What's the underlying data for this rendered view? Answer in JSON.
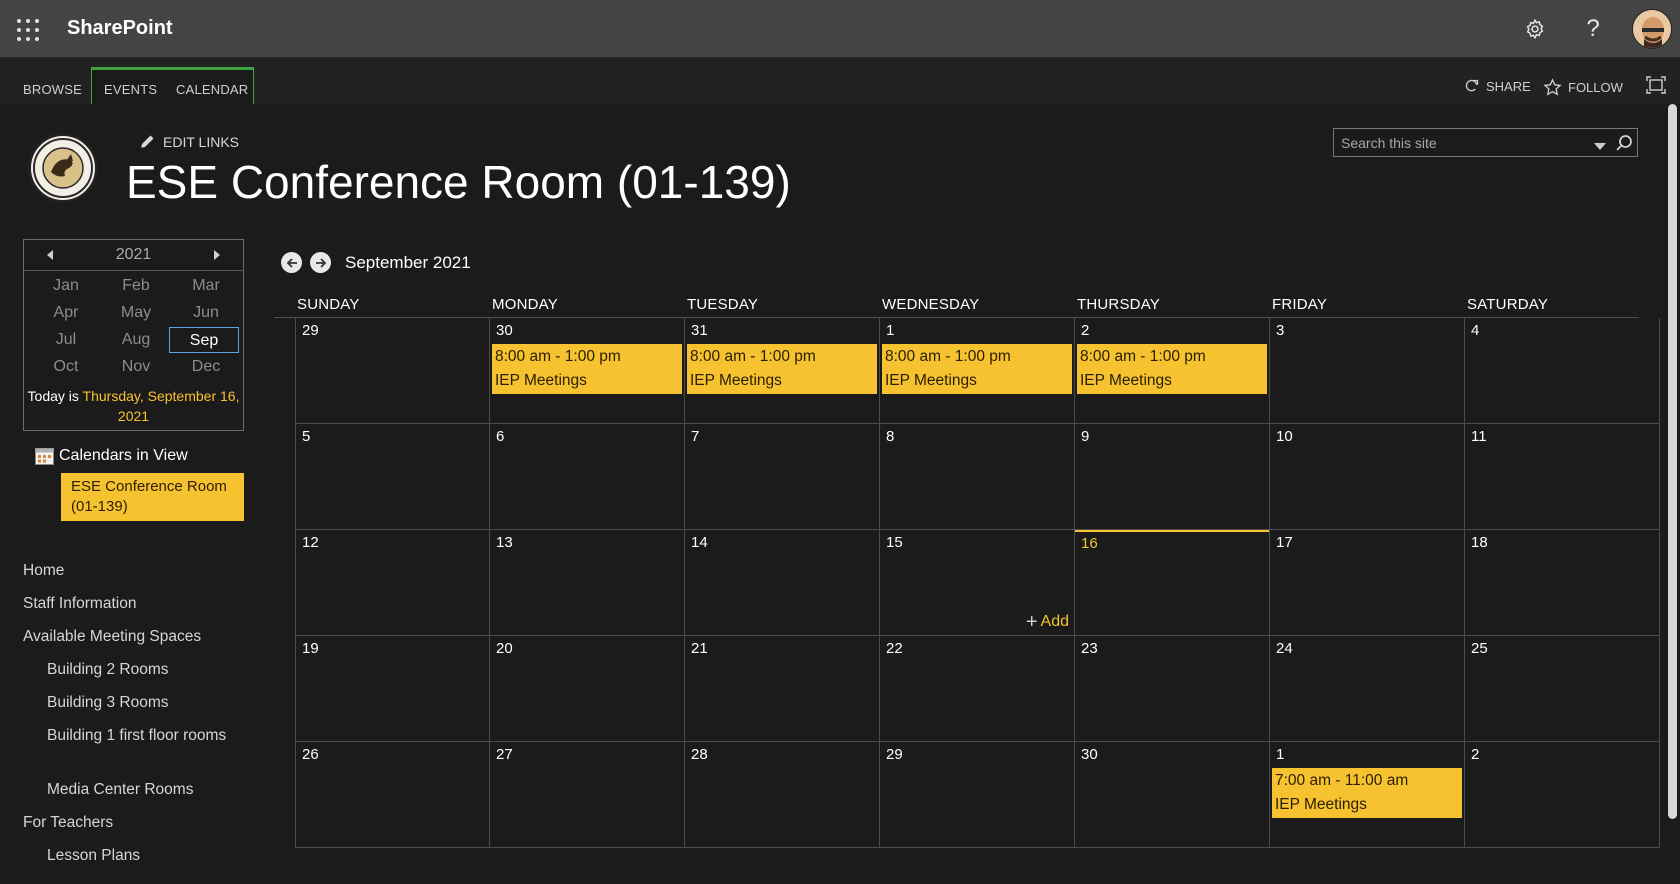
{
  "suitebar": {
    "brand": "SharePoint",
    "icons": [
      "app-launcher-icon",
      "settings-gear-icon",
      "help-question-icon",
      "user-avatar"
    ]
  },
  "ribbon": {
    "tabs": [
      {
        "label": "BROWSE"
      },
      {
        "label": "EVENTS"
      },
      {
        "label": "CALENDAR"
      }
    ],
    "share_label": "SHARE",
    "follow_label": "FOLLOW",
    "accent_color": "#3fa33f"
  },
  "header": {
    "edit_links": "EDIT LINKS",
    "title": "ESE Conference Room (01-139)",
    "logo_name": "school-logo"
  },
  "search": {
    "placeholder": "Search this site"
  },
  "date_picker": {
    "year": "2021",
    "months": [
      "Jan",
      "Feb",
      "Mar",
      "Apr",
      "May",
      "Jun",
      "Jul",
      "Aug",
      "Sep",
      "Oct",
      "Nov",
      "Dec"
    ],
    "selected_month": "Sep",
    "today_prefix": "Today is ",
    "today_link": "Thursday, September 16, 2021"
  },
  "calendars_in_view": {
    "label": "Calendars in View",
    "items": [
      "ESE Conference Room (01-139)"
    ]
  },
  "left_nav": [
    {
      "label": "Home",
      "level": 1
    },
    {
      "label": "Staff Information",
      "level": 1
    },
    {
      "label": "Available Meeting Spaces",
      "level": 1
    },
    {
      "label": "Building 2 Rooms",
      "level": 2
    },
    {
      "label": "Building 3 Rooms",
      "level": 2
    },
    {
      "label": "Building 1 first floor rooms",
      "level": 2
    },
    {
      "label": "Media Center Rooms",
      "level": 2
    },
    {
      "label": "For Teachers",
      "level": 1
    },
    {
      "label": "Lesson Plans",
      "level": 2
    }
  ],
  "calendar": {
    "month_label": "September 2021",
    "day_names": [
      "SUNDAY",
      "MONDAY",
      "TUESDAY",
      "WEDNESDAY",
      "THURSDAY",
      "FRIDAY",
      "SATURDAY"
    ],
    "today_date": "16",
    "add_label": "Add",
    "highlight_color": "#f7c230",
    "weeks": [
      [
        {
          "d": "29"
        },
        {
          "d": "30",
          "events": [
            {
              "time": "8:00 am - 1:00 pm",
              "title": "IEP Meetings"
            }
          ]
        },
        {
          "d": "31",
          "events": [
            {
              "time": "8:00 am - 1:00 pm",
              "title": "IEP Meetings"
            }
          ]
        },
        {
          "d": "1",
          "events": [
            {
              "time": "8:00 am - 1:00 pm",
              "title": "IEP Meetings"
            }
          ]
        },
        {
          "d": "2",
          "events": [
            {
              "time": "8:00 am - 1:00 pm",
              "title": "IEP Meetings"
            }
          ]
        },
        {
          "d": "3"
        },
        {
          "d": "4"
        }
      ],
      [
        {
          "d": "5"
        },
        {
          "d": "6"
        },
        {
          "d": "7"
        },
        {
          "d": "8"
        },
        {
          "d": "9"
        },
        {
          "d": "10"
        },
        {
          "d": "11"
        }
      ],
      [
        {
          "d": "12"
        },
        {
          "d": "13"
        },
        {
          "d": "14"
        },
        {
          "d": "15",
          "add": true
        },
        {
          "d": "16",
          "today": true
        },
        {
          "d": "17"
        },
        {
          "d": "18"
        }
      ],
      [
        {
          "d": "19"
        },
        {
          "d": "20"
        },
        {
          "d": "21"
        },
        {
          "d": "22"
        },
        {
          "d": "23"
        },
        {
          "d": "24"
        },
        {
          "d": "25"
        }
      ],
      [
        {
          "d": "26"
        },
        {
          "d": "27"
        },
        {
          "d": "28"
        },
        {
          "d": "29"
        },
        {
          "d": "30"
        },
        {
          "d": "1",
          "events": [
            {
              "time": "7:00 am - 11:00 am",
              "title": "IEP Meetings"
            }
          ]
        },
        {
          "d": "2"
        }
      ]
    ]
  }
}
